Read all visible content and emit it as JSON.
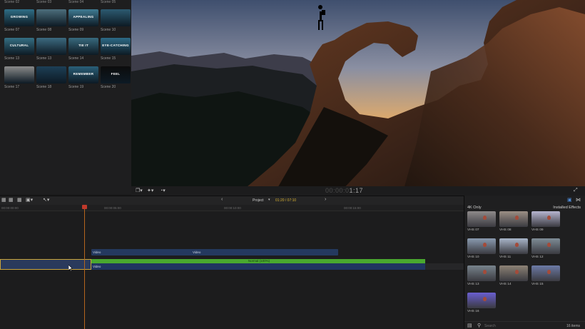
{
  "browser": {
    "top_labels": [
      "Scene 02",
      "Scene 03",
      "Scene 04",
      "Scene 05"
    ],
    "scenes": [
      {
        "label": "Scene 07",
        "title": "GROWING",
        "color": "#2f6e86"
      },
      {
        "label": "Scene 08",
        "title": "",
        "color": "#4c6e7c"
      },
      {
        "label": "Scene 09",
        "title": "APPEALING",
        "color": "#3f7b93"
      },
      {
        "label": "Scene 10",
        "title": "",
        "color": "#2c5a70"
      },
      {
        "label": "Scene 13",
        "title": "CULTURAL",
        "color": "#356f84"
      },
      {
        "label": "Scene 13",
        "title": "",
        "color": "#3c6a80"
      },
      {
        "label": "Scene 14",
        "title": "TIE IT",
        "color": "#386a7e"
      },
      {
        "label": "Scene 15",
        "title": "EYE-CATCHING",
        "color": "#2d6a86"
      },
      {
        "label": "Scene 17",
        "title": "",
        "color": "#8a8a8a"
      },
      {
        "label": "Scene 18",
        "title": "",
        "color": "#1d3f56"
      },
      {
        "label": "Scene 19",
        "title": "REMEMBER",
        "color": "#2a5f78"
      },
      {
        "label": "Scene 20",
        "title": "FEEL",
        "color": "#0c0c0c"
      }
    ]
  },
  "viewer": {
    "timecode_dim": "00:00:0",
    "timecode": "1:17"
  },
  "timeline": {
    "project_label": "Project",
    "project_timecode": "01:20 / 07:10",
    "ruler": [
      "00:00:00:00",
      "00:00:05:00",
      "00:00:10:00",
      "00:00:15:00"
    ],
    "clips": [
      {
        "label": "Video"
      },
      {
        "label": "Video"
      },
      {
        "label": "Normal (100%)"
      },
      {
        "label": "Video"
      }
    ]
  },
  "effects": {
    "category": "4K Only",
    "installed": "Installed Effects",
    "items": [
      {
        "label": "VHS 07",
        "color": "#8e8a8a"
      },
      {
        "label": "VHS 08",
        "color": "#9c8f85"
      },
      {
        "label": "VHS 09",
        "color": "#b7b5d0"
      },
      {
        "label": "VHS 10",
        "color": "#8a9bb0"
      },
      {
        "label": "VHS 11",
        "color": "#a9b6c9"
      },
      {
        "label": "VHS 12",
        "color": "#7f8d97"
      },
      {
        "label": "VHS 13",
        "color": "#78838c"
      },
      {
        "label": "VHS 14",
        "color": "#8d8275"
      },
      {
        "label": "VHS 15",
        "color": "#6c7aa6"
      },
      {
        "label": "VHS 16",
        "color": "#6a5fd0"
      }
    ],
    "search_placeholder": "Search",
    "count": "16 items"
  }
}
